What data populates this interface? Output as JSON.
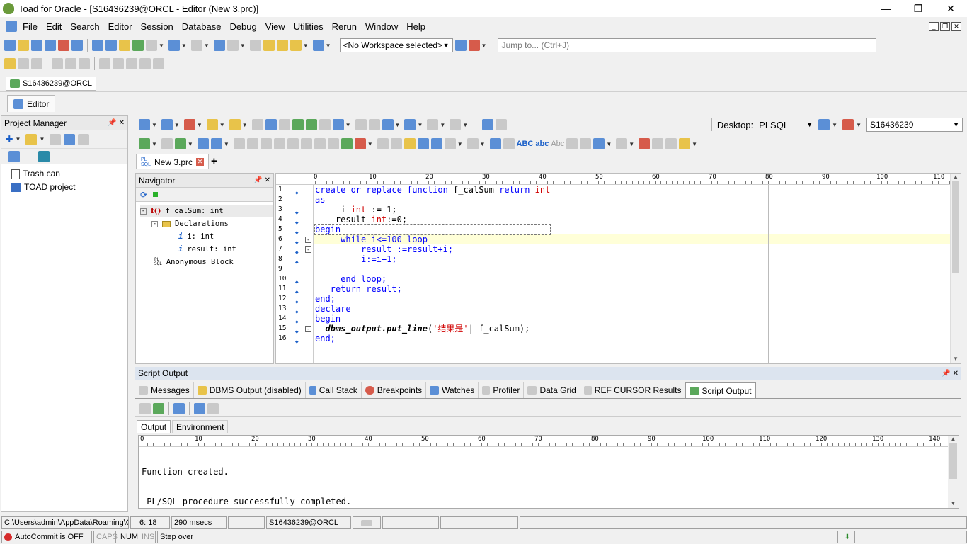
{
  "window": {
    "title": "Toad for Oracle - [S16436239@ORCL - Editor (New 3.prc)]"
  },
  "menu": [
    "File",
    "Edit",
    "Search",
    "Editor",
    "Session",
    "Database",
    "Debug",
    "View",
    "Utilities",
    "Rerun",
    "Window",
    "Help"
  ],
  "toolbar": {
    "workspace": "<No Workspace selected>",
    "jump_placeholder": "Jump to... (Ctrl+J)",
    "desktop_label": "Desktop:",
    "desktop_value": "PLSQL",
    "schema_value": "S16436239"
  },
  "connection_tab": "S16436239@ORCL",
  "editor_tab": "Editor",
  "project_manager": {
    "title": "Project Manager",
    "items": [
      "Trash can",
      "TOAD project"
    ]
  },
  "file_tab": "New 3.prc",
  "navigator": {
    "title": "Navigator",
    "root": "f_calSum: int",
    "declarations": "Declarations",
    "vars": [
      "i: int",
      "result: int"
    ],
    "anon": "Anonymous Block"
  },
  "ruler": [
    "0",
    "10",
    "20",
    "30",
    "40",
    "50",
    "60",
    "70",
    "80",
    "90",
    "100",
    "110"
  ],
  "line_numbers": [
    "1",
    "2",
    "3",
    "4",
    "5",
    "6",
    "7",
    "8",
    "9",
    "10",
    "11",
    "12",
    "13",
    "14",
    "15",
    "16"
  ],
  "code": {
    "l1_kw1": "create or replace function",
    "l1_name": " f_calSum ",
    "l1_kw2": "return",
    "l1_type": " int",
    "l2": "as",
    "l3_a": "     i ",
    "l3_type": "int",
    "l3_b": " := 1;",
    "l4_a": "    result ",
    "l4_type": "int",
    "l4_b": ":=0;",
    "l5": "begin",
    "l6": "     while i<=100 loop",
    "l7": "         result :=result+i;",
    "l8": "         i:=i+1;",
    "l9": "",
    "l10": "     end loop;",
    "l11": "   return result;",
    "l12": "end;",
    "l13": "declare",
    "l14": "begin",
    "l15_a": "  dbms_output.put_line",
    "l15_b": "(",
    "l15_str": "'结果是'",
    "l15_c": "||f_calSum);",
    "l16": "end;"
  },
  "script_output": {
    "title": "Script Output",
    "tabs": [
      "Messages",
      "DBMS Output (disabled)",
      "Call Stack",
      "Breakpoints",
      "Watches",
      "Profiler",
      "Data Grid",
      "REF CURSOR Results",
      "Script Output"
    ],
    "subtabs": [
      "Output",
      "Environment"
    ],
    "ruler": [
      "0",
      "10",
      "20",
      "30",
      "40",
      "50",
      "60",
      "70",
      "80",
      "90",
      "100",
      "110",
      "120",
      "130",
      "140"
    ],
    "lines": [
      "Function created.",
      " PL/SQL procedure successfully completed."
    ]
  },
  "status": {
    "path": "C:\\Users\\admin\\AppData\\Roaming\\Q",
    "cursor": "6: 18",
    "time": "290 msecs",
    "connection": "S16436239@ORCL",
    "autocommit": "AutoCommit is OFF",
    "caps": "CAPS",
    "num": "NUM",
    "ins": "INS",
    "message": "Step over"
  },
  "colors": {
    "keyword": "#0000ff",
    "string": "#d00000",
    "current_line": "#ffffd8"
  }
}
